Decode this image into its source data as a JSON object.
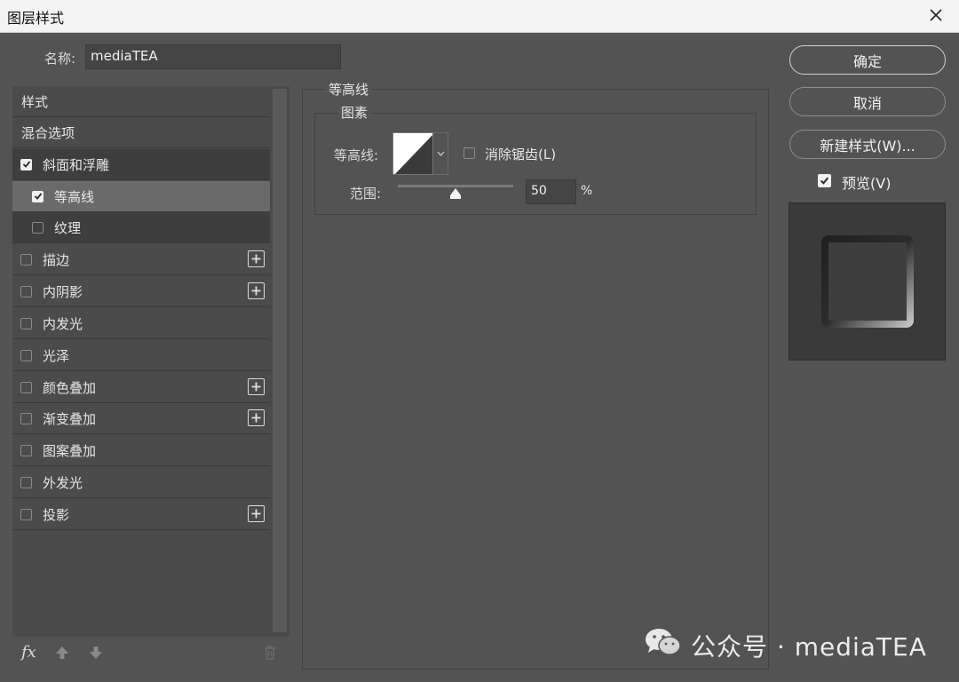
{
  "window": {
    "title": "图层样式"
  },
  "name_field": {
    "label": "名称:",
    "value": "mediaTEA"
  },
  "style_list": {
    "header": "样式",
    "blend_options": "混合选项",
    "items": [
      {
        "label": "斜面和浮雕",
        "checked": true
      },
      {
        "label": "等高线",
        "checked": true
      },
      {
        "label": "纹理",
        "checked": false
      },
      {
        "label": "描边",
        "checked": false
      },
      {
        "label": "内阴影",
        "checked": false
      },
      {
        "label": "内发光",
        "checked": false
      },
      {
        "label": "光泽",
        "checked": false
      },
      {
        "label": "颜色叠加",
        "checked": false
      },
      {
        "label": "渐变叠加",
        "checked": false
      },
      {
        "label": "图案叠加",
        "checked": false
      },
      {
        "label": "外发光",
        "checked": false
      },
      {
        "label": "投影",
        "checked": false
      }
    ],
    "fx_label": "fx"
  },
  "panel": {
    "group_title": "等高线",
    "sub_title": "图素",
    "contour_label": "等高线:",
    "anti_alias_label": "消除锯齿(L)",
    "anti_alias_checked": false,
    "range_label": "范围:",
    "range_value": "50",
    "range_unit": "%",
    "range_fraction": 0.5
  },
  "buttons": {
    "ok": "确定",
    "cancel": "取消",
    "new_style": "新建样式(W)..."
  },
  "preview": {
    "label": "预览(V)",
    "checked": true
  },
  "watermark": {
    "text": "公众号 · mediaTEA"
  },
  "colors": {
    "background": "#535353",
    "titlebar": "#f3f3f3",
    "selected_row": "#6a6a6a"
  }
}
